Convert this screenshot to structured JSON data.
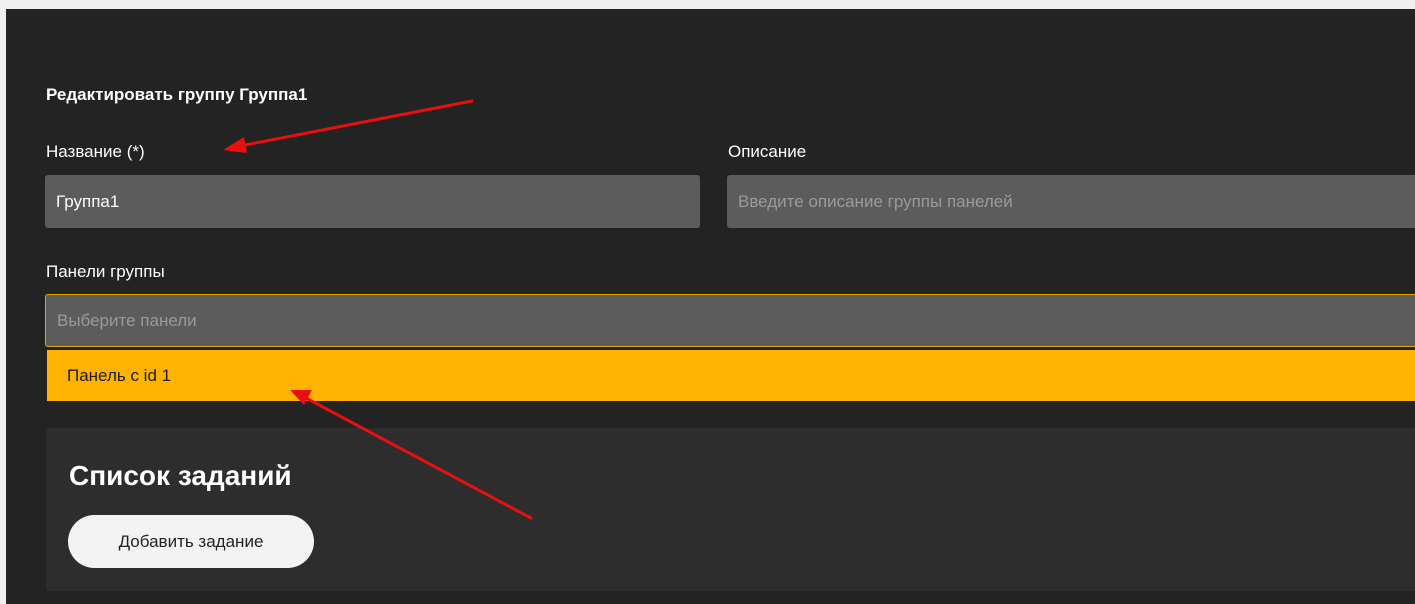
{
  "form": {
    "heading": "Редактировать группу Группа1",
    "name_label": "Название (*)",
    "name_value": "Группа1",
    "description_label": "Описание",
    "description_placeholder": "Введите описание группы панелей",
    "panels_label": "Панели группы",
    "panels_placeholder": "Выберите панели",
    "panels_options": [
      "Панель c id 1"
    ]
  },
  "tasks": {
    "title": "Список заданий",
    "add_button": "Добавить задание"
  },
  "colors": {
    "background": "#232323",
    "input": "#5c5c5c",
    "accent": "#ffb300",
    "annotation_arrow": "#e8100e"
  }
}
